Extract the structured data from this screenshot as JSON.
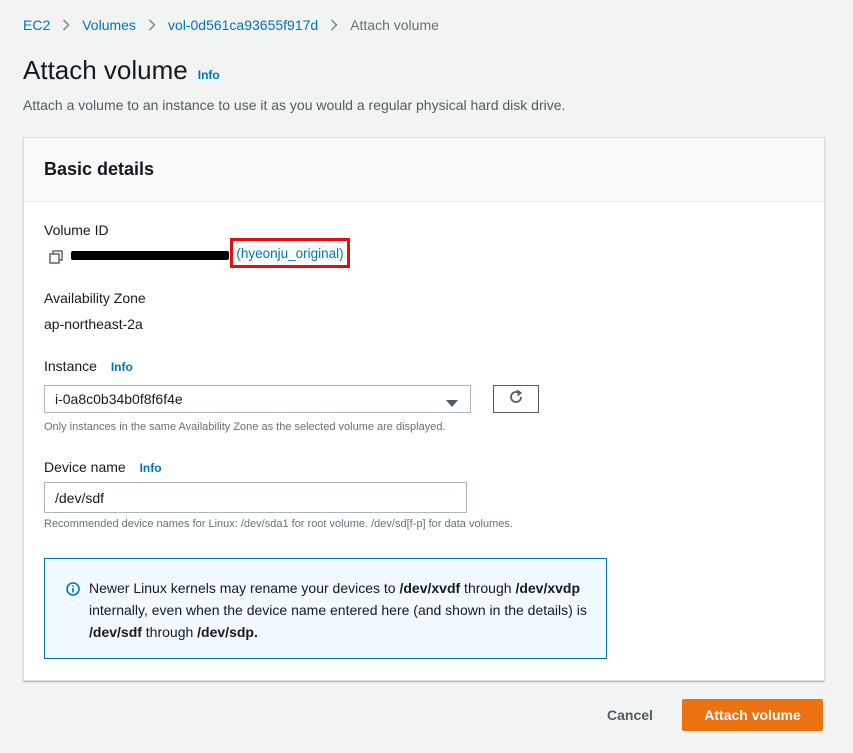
{
  "breadcrumb": [
    "EC2",
    "Volumes",
    "vol-0d561ca93655f917d",
    "Attach volume"
  ],
  "page": {
    "title": "Attach volume",
    "info_label": "Info",
    "subtitle": "Attach a volume to an instance to use it as you would a regular physical hard disk drive."
  },
  "panel": {
    "header": "Basic details",
    "volume_id_label": "Volume ID",
    "volume_name": "(hyeonju_original)",
    "az_label": "Availability Zone",
    "az_value": "ap-northeast-2a",
    "instance_label": "Instance",
    "instance_info": "Info",
    "instance_value": "i-0a8c0b34b0f8f6f4e",
    "instance_hint": "Only instances in the same Availability Zone as the selected volume are displayed.",
    "device_label": "Device name",
    "device_info": "Info",
    "device_value": "/dev/sdf",
    "device_hint": "Recommended device names for Linux: /dev/sda1 for root volume. /dev/sd[f-p] for data volumes."
  },
  "alert": {
    "t1": "Newer Linux kernels may rename your devices to ",
    "b1": "/dev/xvdf",
    "t2": " through ",
    "b2": "/dev/xvdp",
    "t3": " internally, even when the device name entered here (and shown in the details) is ",
    "b3": "/dev/sdf",
    "t4": " through ",
    "b4": "/dev/sdp."
  },
  "footer": {
    "cancel_label": "Cancel",
    "attach_label": "Attach volume"
  },
  "icons": {
    "copy": "copy-icon",
    "caret": "caret-down-icon",
    "refresh": "refresh-icon",
    "info": "info-circle-icon",
    "chevron": "chevron-right-icon"
  },
  "colors": {
    "link": "#0073bb",
    "primary_button": "#ec7211",
    "highlight_box": "#e01010",
    "alert_border": "#0073bb",
    "alert_bg": "#f1faff"
  }
}
